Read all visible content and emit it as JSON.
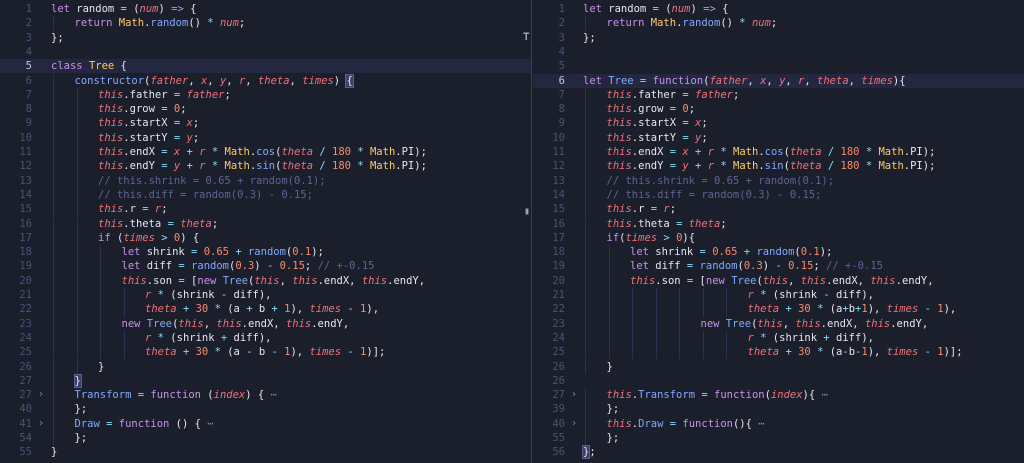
{
  "panes": [
    {
      "id": "left",
      "active_line": 5,
      "lines": [
        {
          "n": "1",
          "fold": false,
          "ind": 0,
          "html": "<span class='kw'>let</span> random <span class='op'>=</span> (<span class='pa'>num</span>) <span class='kw'>=&gt;</span> {"
        },
        {
          "n": "2",
          "fold": false,
          "ind": 1,
          "html": "<span class='kw'>return</span> <span class='cls'>Math</span>.<span class='fn'>random</span>() <span class='op'>*</span> <span class='pa'>num</span>;"
        },
        {
          "n": "3",
          "fold": false,
          "ind": 0,
          "html": "};"
        },
        {
          "n": "4",
          "fold": false,
          "ind": 0,
          "html": ""
        },
        {
          "n": "5",
          "fold": false,
          "ind": 0,
          "html": "<span class='kw'>class</span> <span class='cls'>Tree</span> {"
        },
        {
          "n": "6",
          "fold": false,
          "ind": 1,
          "html": "<span class='fn'>constructor</span>(<span class='pa'>father</span>, <span class='pa'>x</span>, <span class='pa'>y</span>, <span class='pa'>r</span>, <span class='pa'>theta</span>, <span class='pa'>times</span>) <span class='sel'>{</span>"
        },
        {
          "n": "7",
          "fold": false,
          "ind": 2,
          "html": "<span class='th'>this</span>.father <span class='op'>=</span> <span class='pa'>father</span>;"
        },
        {
          "n": "8",
          "fold": false,
          "ind": 2,
          "html": "<span class='th'>this</span>.grow <span class='op'>=</span> <span class='num'>0</span>;"
        },
        {
          "n": "9",
          "fold": false,
          "ind": 2,
          "html": "<span class='th'>this</span>.startX <span class='op'>=</span> <span class='pa'>x</span>;"
        },
        {
          "n": "10",
          "fold": false,
          "ind": 2,
          "html": "<span class='th'>this</span>.startY <span class='op'>=</span> <span class='pa'>y</span>;"
        },
        {
          "n": "11",
          "fold": false,
          "ind": 2,
          "html": "<span class='th'>this</span>.endX <span class='op'>=</span> <span class='pa'>x</span> <span class='op'>+</span> <span class='pa'>r</span> <span class='op'>*</span> <span class='cls'>Math</span>.<span class='fn'>cos</span>(<span class='pa'>theta</span> <span class='op'>/</span> <span class='num'>180</span> <span class='op'>*</span> <span class='cls'>Math</span>.PI);"
        },
        {
          "n": "12",
          "fold": false,
          "ind": 2,
          "html": "<span class='th'>this</span>.endY <span class='op'>=</span> <span class='pa'>y</span> <span class='op'>+</span> <span class='pa'>r</span> <span class='op'>*</span> <span class='cls'>Math</span>.<span class='fn'>sin</span>(<span class='pa'>theta</span> <span class='op'>/</span> <span class='num'>180</span> <span class='op'>*</span> <span class='cls'>Math</span>.PI);"
        },
        {
          "n": "13",
          "fold": false,
          "ind": 2,
          "html": "<span class='cm'>// this.shrink = 0.65 + random(0.1);</span>"
        },
        {
          "n": "14",
          "fold": false,
          "ind": 2,
          "html": "<span class='cm'>// this.diff = random(0.3) - 0.15;</span>"
        },
        {
          "n": "15",
          "fold": false,
          "ind": 2,
          "html": "<span class='th'>this</span>.r <span class='op'>=</span> <span class='pa'>r</span>;"
        },
        {
          "n": "16",
          "fold": false,
          "ind": 2,
          "html": "<span class='th'>this</span>.theta <span class='op'>=</span> <span class='pa'>theta</span>;"
        },
        {
          "n": "17",
          "fold": false,
          "ind": 2,
          "html": "<span class='kw'>if</span> (<span class='pa'>times</span> <span class='op'>&gt;</span> <span class='num'>0</span>) {"
        },
        {
          "n": "18",
          "fold": false,
          "ind": 3,
          "html": "<span class='kw'>let</span> shrink <span class='op'>=</span> <span class='num'>0.65</span> <span class='op'>+</span> <span class='fn'>random</span>(<span class='num'>0.1</span>);"
        },
        {
          "n": "19",
          "fold": false,
          "ind": 3,
          "html": "<span class='kw'>let</span> diff <span class='op'>=</span> <span class='fn'>random</span>(<span class='num'>0.3</span>) <span class='op'>-</span> <span class='num'>0.15</span>; <span class='cm'>// +-0.15</span>"
        },
        {
          "n": "20",
          "fold": false,
          "ind": 3,
          "html": "<span class='th'>this</span>.son <span class='op'>=</span> [<span class='kw'>new</span> <span class='fn'>Tree</span>(<span class='th'>this</span>, <span class='th'>this</span>.endX, <span class='th'>this</span>.endY,"
        },
        {
          "n": "21",
          "fold": false,
          "ind": 4,
          "html": "<span class='pa'>r</span> <span class='op'>*</span> (shrink <span class='op'>-</span> diff),"
        },
        {
          "n": "22",
          "fold": false,
          "ind": 4,
          "html": "<span class='pa'>theta</span> <span class='op'>+</span> <span class='num'>30</span> <span class='op'>*</span> (a <span class='op'>+</span> b <span class='op'>+</span> <span class='num'>1</span>), <span class='pa'>times</span> <span class='op'>-</span> <span class='num'>1</span>),"
        },
        {
          "n": "23",
          "fold": false,
          "ind": 3,
          "html": "<span class='kw'>new</span> <span class='fn'>Tree</span>(<span class='th'>this</span>, <span class='th'>this</span>.endX, <span class='th'>this</span>.endY,"
        },
        {
          "n": "24",
          "fold": false,
          "ind": 4,
          "html": "<span class='pa'>r</span> <span class='op'>*</span> (shrink <span class='op'>+</span> diff),"
        },
        {
          "n": "25",
          "fold": false,
          "ind": 4,
          "html": "<span class='pa'>theta</span> <span class='op'>+</span> <span class='num'>30</span> <span class='op'>*</span> (a <span class='op'>-</span> b <span class='op'>-</span> <span class='num'>1</span>), <span class='pa'>times</span> <span class='op'>-</span> <span class='num'>1</span>)];"
        },
        {
          "n": "26",
          "fold": false,
          "ind": 2,
          "html": "}"
        },
        {
          "n": "27",
          "fold": false,
          "ind": 1,
          "html": "<span class='sel'>}</span>"
        },
        {
          "n": "27",
          "fold": true,
          "ind": 1,
          "html": "<span class='fn'>Transform</span> <span class='op'>=</span> <span class='kw'>function</span> (<span class='pa'>index</span>) { <span class='dots'>⋯</span>"
        },
        {
          "n": "40",
          "fold": false,
          "ind": 1,
          "html": "};"
        },
        {
          "n": "41",
          "fold": true,
          "ind": 1,
          "html": "<span class='fn'>Draw</span> <span class='op'>=</span> <span class='kw'>function</span> () { <span class='dots'>⋯</span>"
        },
        {
          "n": "54",
          "fold": false,
          "ind": 1,
          "html": "};"
        },
        {
          "n": "55",
          "fold": false,
          "ind": 0,
          "html": "}"
        }
      ]
    },
    {
      "id": "right",
      "active_line": 6,
      "lines": [
        {
          "n": "1",
          "fold": false,
          "ind": 0,
          "html": "<span class='kw'>let</span> random <span class='op'>=</span> (<span class='pa'>num</span>) <span class='kw'>=&gt;</span> {"
        },
        {
          "n": "2",
          "fold": false,
          "ind": 1,
          "html": "<span class='kw'>return</span> <span class='cls'>Math</span>.<span class='fn'>random</span>() <span class='op'>*</span> <span class='pa'>num</span>;"
        },
        {
          "n": "3",
          "fold": false,
          "ind": 0,
          "html": "};"
        },
        {
          "n": "4",
          "fold": false,
          "ind": 0,
          "html": ""
        },
        {
          "n": "5",
          "fold": false,
          "ind": 0,
          "html": ""
        },
        {
          "n": "6",
          "fold": false,
          "ind": 0,
          "html": "<span class='kw'>let</span> <span class='fn'>Tree</span> <span class='op'>=</span> <span class='kw'>function</span>(<span class='pa'>father</span>, <span class='pa'>x</span>, <span class='pa'>y</span>, <span class='pa'>r</span>, <span class='pa'>theta</span>, <span class='pa'>times</span>){"
        },
        {
          "n": "7",
          "fold": false,
          "ind": 1,
          "html": "<span class='th'>this</span>.father <span class='op'>=</span> <span class='pa'>father</span>;"
        },
        {
          "n": "8",
          "fold": false,
          "ind": 1,
          "html": "<span class='th'>this</span>.grow <span class='op'>=</span> <span class='num'>0</span>;"
        },
        {
          "n": "9",
          "fold": false,
          "ind": 1,
          "html": "<span class='th'>this</span>.startX <span class='op'>=</span> <span class='pa'>x</span>;"
        },
        {
          "n": "10",
          "fold": false,
          "ind": 1,
          "html": "<span class='th'>this</span>.startY <span class='op'>=</span> <span class='pa'>y</span>;"
        },
        {
          "n": "11",
          "fold": false,
          "ind": 1,
          "html": "<span class='th'>this</span>.endX <span class='op'>=</span> <span class='pa'>x</span> <span class='op'>+</span> <span class='pa'>r</span> <span class='op'>*</span> <span class='cls'>Math</span>.<span class='fn'>cos</span>(<span class='pa'>theta</span> <span class='op'>/</span> <span class='num'>180</span> <span class='op'>*</span> <span class='cls'>Math</span>.PI);"
        },
        {
          "n": "12",
          "fold": false,
          "ind": 1,
          "html": "<span class='th'>this</span>.endY <span class='op'>=</span> <span class='pa'>y</span> <span class='op'>+</span> <span class='pa'>r</span> <span class='op'>*</span> <span class='cls'>Math</span>.<span class='fn'>sin</span>(<span class='pa'>theta</span> <span class='op'>/</span> <span class='num'>180</span> <span class='op'>*</span> <span class='cls'>Math</span>.PI);"
        },
        {
          "n": "13",
          "fold": false,
          "ind": 1,
          "html": "<span class='cm'>// this.shrink = 0.65 + random(0.1);</span>"
        },
        {
          "n": "14",
          "fold": false,
          "ind": 1,
          "html": "<span class='cm'>// this.diff = random(0.3) - 0.15;</span>"
        },
        {
          "n": "15",
          "fold": false,
          "ind": 1,
          "html": "<span class='th'>this</span>.r <span class='op'>=</span> <span class='pa'>r</span>;"
        },
        {
          "n": "16",
          "fold": false,
          "ind": 1,
          "html": "<span class='th'>this</span>.theta <span class='op'>=</span> <span class='pa'>theta</span>;"
        },
        {
          "n": "17",
          "fold": false,
          "ind": 1,
          "html": "<span class='kw'>if</span>(<span class='pa'>times</span> <span class='op'>&gt;</span> <span class='num'>0</span>){"
        },
        {
          "n": "18",
          "fold": false,
          "ind": 2,
          "html": "<span class='kw'>let</span> shrink <span class='op'>=</span> <span class='num'>0.65</span> <span class='op'>+</span> <span class='fn'>random</span>(<span class='num'>0.1</span>);"
        },
        {
          "n": "19",
          "fold": false,
          "ind": 2,
          "html": "<span class='kw'>let</span> diff <span class='op'>=</span> <span class='fn'>random</span>(<span class='num'>0.3</span>) <span class='op'>-</span> <span class='num'>0.15</span>; <span class='cm'>// +-0.15</span>"
        },
        {
          "n": "20",
          "fold": false,
          "ind": 2,
          "html": "<span class='th'>this</span>.son <span class='op'>=</span> [<span class='kw'>new</span> <span class='fn'>Tree</span>(<span class='th'>this</span>, <span class='th'>this</span>.endX, <span class='th'>this</span>.endY,"
        },
        {
          "n": "21",
          "fold": false,
          "ind": 7,
          "html": "<span class='pa'>r</span> <span class='op'>*</span> (shrink <span class='op'>-</span> diff),"
        },
        {
          "n": "22",
          "fold": false,
          "ind": 7,
          "html": "<span class='pa'>theta</span> <span class='op'>+</span> <span class='num'>30</span> <span class='op'>*</span> (a<span class='op'>+</span>b<span class='op'>+</span><span class='num'>1</span>), <span class='pa'>times</span> <span class='op'>-</span> <span class='num'>1</span>),"
        },
        {
          "n": "23",
          "fold": false,
          "ind": 5,
          "html": "<span class='kw'>new</span> <span class='fn'>Tree</span>(<span class='th'>this</span>, <span class='th'>this</span>.endX, <span class='th'>this</span>.endY,"
        },
        {
          "n": "24",
          "fold": false,
          "ind": 7,
          "html": "<span class='pa'>r</span> <span class='op'>*</span> (shrink <span class='op'>+</span> diff),"
        },
        {
          "n": "25",
          "fold": false,
          "ind": 7,
          "html": "<span class='pa'>theta</span> <span class='op'>+</span> <span class='num'>30</span> <span class='op'>*</span> (a<span class='op'>-</span>b<span class='op'>-</span><span class='num'>1</span>), <span class='pa'>times</span> <span class='op'>-</span> <span class='num'>1</span>)];"
        },
        {
          "n": "26",
          "fold": false,
          "ind": 1,
          "html": "}"
        },
        {
          "n": "26",
          "fold": false,
          "ind": 0,
          "html": ""
        },
        {
          "n": "27",
          "fold": true,
          "ind": 1,
          "html": "<span class='th'>this</span>.<span class='fn'>Transform</span> <span class='op'>=</span> <span class='kw'>function</span>(<span class='pa'>index</span>){ <span class='dots'>⋯</span>"
        },
        {
          "n": "39",
          "fold": false,
          "ind": 1,
          "html": "};"
        },
        {
          "n": "40",
          "fold": true,
          "ind": 1,
          "html": "<span class='th'>this</span>.<span class='fn'>Draw</span> <span class='op'>=</span> <span class='kw'>function</span>(){ <span class='dots'>⋯</span>"
        },
        {
          "n": "55",
          "fold": false,
          "ind": 1,
          "html": "};"
        },
        {
          "n": "56",
          "fold": false,
          "ind": 0,
          "html": "<span class='sel'>}</span>;"
        }
      ]
    }
  ]
}
